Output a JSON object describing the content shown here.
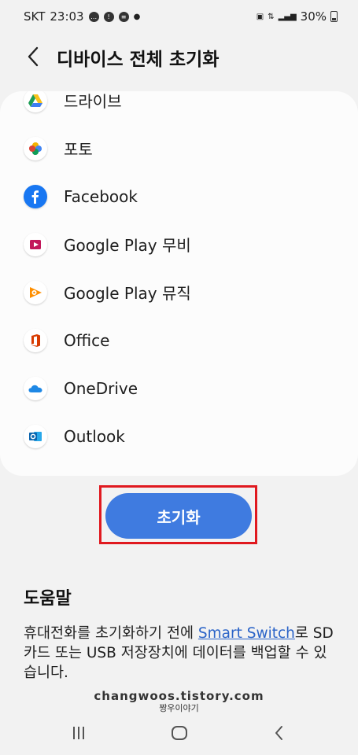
{
  "status_bar": {
    "carrier": "SKT",
    "time": "23:03",
    "battery": "30%"
  },
  "header": {
    "title": "디바이스 전체 초기화"
  },
  "apps": [
    {
      "label": "드라이브",
      "icon": "google-drive-icon"
    },
    {
      "label": "포토",
      "icon": "google-photos-icon"
    },
    {
      "label": "Facebook",
      "icon": "facebook-icon"
    },
    {
      "label": "Google Play 무비",
      "icon": "play-movies-icon"
    },
    {
      "label": "Google Play 뮤직",
      "icon": "play-music-icon"
    },
    {
      "label": "Office",
      "icon": "office-icon"
    },
    {
      "label": "OneDrive",
      "icon": "onedrive-icon"
    },
    {
      "label": "Outlook",
      "icon": "outlook-icon"
    }
  ],
  "reset_button": {
    "label": "초기화"
  },
  "help": {
    "title": "도움말",
    "text_before": "휴대전화를 초기화하기 전에 ",
    "link": "Smart Switch",
    "text_after": "로 SD 카드 또는 USB 저장장치에 데이터를 백업할 수 있습니다."
  },
  "watermark": {
    "url": "changwoos.tistory.com",
    "sub": "짱우이야기"
  },
  "colors": {
    "accent": "#3f7be0",
    "highlight_frame": "#e0191f",
    "link": "#2b64c8"
  }
}
